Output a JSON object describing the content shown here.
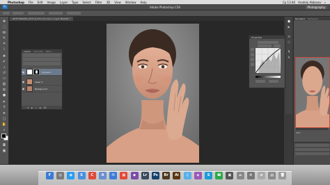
{
  "menubar": {
    "app": "Photoshop",
    "items": [
      "File",
      "Edit",
      "Image",
      "Layer",
      "Type",
      "Select",
      "Filter",
      "3D",
      "View",
      "Window",
      "Help"
    ],
    "time": "Ср 13:46",
    "user": "Anatoly Abbasov"
  },
  "appbar": {
    "title": "Adobe Photoshop CS6",
    "workspace": "Photography"
  },
  "document": {
    "tab_title": "GETTYIMAGES_0170 @ 25% (Curves 1, Layer Mask/8) *",
    "tab2": "×"
  },
  "layers_panel": {
    "tabs": [
      "Layers",
      "Channels",
      "Paths"
    ],
    "layers": [
      {
        "name": "Curves 1"
      },
      {
        "name": "Layer 3"
      },
      {
        "name": "Background"
      }
    ],
    "footer_icons": [
      "fx",
      "◐",
      "▭",
      "▤",
      "⌫"
    ]
  },
  "properties_panel": {
    "title": "Properties",
    "preset_label": "Curves",
    "channel": "RGB",
    "auto_label": "Auto"
  },
  "navigator": {
    "tabs": [
      "Navigator",
      "Histogram"
    ],
    "zoom": "25%"
  },
  "dock_apps": [
    {
      "label": "F",
      "color": "#3a7bd5"
    },
    {
      "label": "◎",
      "color": "#7a7a7a"
    },
    {
      "label": "◉",
      "color": "#2a9df4"
    },
    {
      "label": "S",
      "color": "#4a8fe0"
    },
    {
      "label": "C",
      "color": "#dd4b3e"
    },
    {
      "label": "A",
      "color": "#6b8ecf"
    },
    {
      "label": "✉",
      "color": "#3d7dd6"
    },
    {
      "label": "▦",
      "color": "#e24a3a"
    },
    {
      "label": "◆",
      "color": "#7d4ba8"
    },
    {
      "label": "Lr",
      "color": "#3b4a5e"
    },
    {
      "label": "Ps",
      "color": "#15436b"
    },
    {
      "label": "Br",
      "color": "#4d3b1f"
    },
    {
      "label": "Ai",
      "color": "#5c3713"
    },
    {
      "label": "♫",
      "color": "#5ab0e8"
    },
    {
      "label": "◈",
      "color": "#9b59b6"
    },
    {
      "label": "S",
      "color": "#1d9bd9"
    },
    {
      "label": "☎",
      "color": "#2ca84a"
    },
    {
      "label": "▣",
      "color": "#555"
    },
    {
      "label": "⌂",
      "color": "#888"
    },
    {
      "label": "⚙",
      "color": "#777"
    },
    {
      "label": "≡",
      "color": "#aaa"
    },
    {
      "label": "▤",
      "color": "#8a8a8a"
    },
    {
      "label": "🗑",
      "color": "#9a9a9a"
    }
  ]
}
